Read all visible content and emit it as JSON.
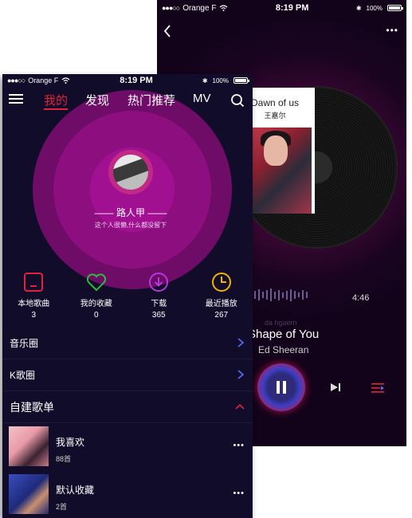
{
  "player": {
    "status": {
      "carrier": "Orange F",
      "time": "8:19 PM",
      "battery": "100%"
    },
    "now_playing": {
      "title": "Dawn of us",
      "artist": "王嘉尔"
    },
    "duration": "4:46",
    "ghost_line": "da hgaern",
    "track_title": "Shape of You",
    "track_artist": "Ed Sheeran",
    "icons": {
      "back": "back-chevron-icon",
      "more": "more-dots-icon",
      "play": "pause-icon",
      "next": "next-icon",
      "playlist": "playlist-icon"
    },
    "colors": {
      "accent": "#d4173f",
      "wave": "#6f5b93"
    }
  },
  "mine": {
    "status": {
      "carrier": "Orange F",
      "time": "8:19 PM",
      "battery": "100%"
    },
    "tabs": [
      {
        "label": "我的",
        "active": true
      },
      {
        "label": "发现",
        "active": false
      },
      {
        "label": "热门推荐",
        "active": false
      },
      {
        "label": "MV",
        "active": false
      }
    ],
    "profile": {
      "name": "—— 路人甲 ——",
      "signature": "这个人很懒,什么都没留下"
    },
    "quick": [
      {
        "label": "本地歌曲",
        "count": "3",
        "icon": "local-music-icon",
        "color": "#e0223a"
      },
      {
        "label": "我的收藏",
        "count": "0",
        "icon": "heart-icon",
        "color": "#2dbb3c"
      },
      {
        "label": "下载",
        "count": "365",
        "icon": "download-icon",
        "color": "#b43ad8"
      },
      {
        "label": "最近播放",
        "count": "267",
        "icon": "recent-clock-icon",
        "color": "#f0b400"
      }
    ],
    "rows": [
      {
        "label": "音乐圈"
      },
      {
        "label": "K歌圈"
      }
    ],
    "section_title": "自建歌单",
    "playlists": [
      {
        "name": "我喜欢",
        "count": "88首"
      },
      {
        "name": "默认收藏",
        "count": "2首"
      }
    ],
    "colors": {
      "bg": "#100c2a",
      "accent": "#e0223a",
      "hero": "#a01090"
    }
  }
}
